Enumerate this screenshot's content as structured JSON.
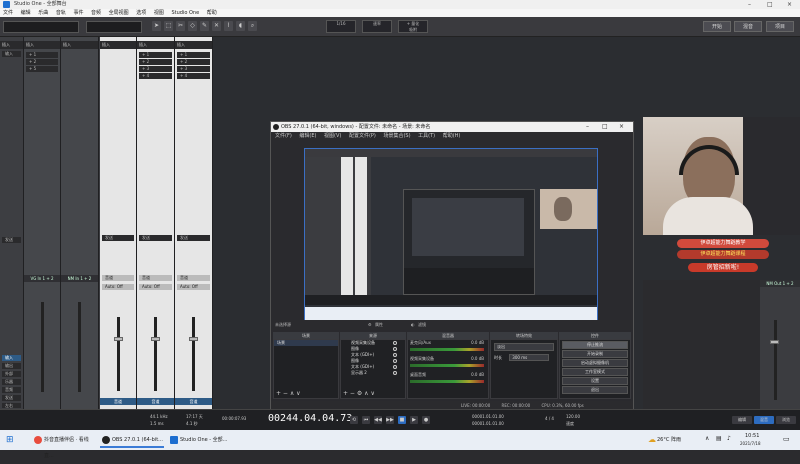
{
  "studio_one": {
    "window_title": "Studio One - 全部舞台",
    "menu": [
      "文件",
      "编辑",
      "乐曲",
      "音轨",
      "事件",
      "音频",
      "全局视图",
      "选项",
      "视图",
      "Studio One",
      "帮助"
    ],
    "toolbar": {
      "display_1": "1/16",
      "display_2": "速率",
      "display_3": "+ 量化",
      "display_4": "吸附",
      "right_btn_1": "开始",
      "right_btn_2": "混音",
      "right_btn_3": "项目"
    },
    "mixer": {
      "insert_label": "插入",
      "inputs_label": "输入",
      "send_label": "发送",
      "routes": [
        "+ 1",
        "+ 2",
        "+ 3",
        "+ 4",
        "+ 5"
      ],
      "bus_in_a": "VG In 1 + 2",
      "bus_in_b": "NM In 1 + 2",
      "auto_label": "Auto: Off",
      "ch_labels": [
        "音道",
        "音道",
        "音道"
      ],
      "ch_names": [
        "音道",
        "音道",
        "音道"
      ],
      "side_buttons": [
        "输入",
        "输出",
        "外部",
        "乐器",
        "音频",
        "发送",
        "左右"
      ],
      "main_bus": "NM Out 1 + 2"
    }
  },
  "obs": {
    "title": "OBS 27.0.1 (64-bit, windows) - 配置文件: 未命名 - 场景: 未命名",
    "menu": [
      "文件(F)",
      "编辑(E)",
      "视图(V)",
      "配置文件(P)",
      "场景集合(S)",
      "工具(T)",
      "帮助(H)"
    ],
    "status_left": "未选择源",
    "status_props": "属性",
    "status_filters": "滤镜",
    "docks": {
      "scenes": "场景",
      "sources": "来源",
      "mixer": "混音器",
      "transitions": "转场特效",
      "controls": "控件"
    },
    "scenes": [
      "场景"
    ],
    "sources": [
      "视频采集设备",
      "图像",
      "文本 (GDI+)",
      "图像",
      "文本 (GDI+)",
      "显示器 2"
    ],
    "mixer_rows": [
      {
        "name": "麦克风/Aux",
        "level": "0.0 dB"
      },
      {
        "name": "视频采集设备",
        "level": "0.0 dB"
      },
      {
        "name": "桌面音频",
        "level": "0.0 dB"
      }
    ],
    "transition": {
      "type": "淡出",
      "duration_label": "时长",
      "duration": "300 ms"
    },
    "controls": [
      "停止推流",
      "开始录制",
      "启动虚拟摄像机",
      "工作室模式",
      "设置",
      "退出"
    ],
    "bottom": {
      "live": "LIVE: 00:00:00",
      "rec": "REC: 00:00:00",
      "cpu": "CPU: 0.3%, 60.00 fps"
    }
  },
  "stream_overlay": {
    "banner_1": "伊卓超能力舞蹈教学",
    "banner_2": "伊卓超能力舞蹈课程",
    "banner_3": "房管招新啦!"
  },
  "transport": {
    "sample_rate": "44.1 kHz",
    "latency": "1.5 ms",
    "time_label": "17:17 天",
    "record_max": "4.1 秒",
    "position_small": "00:00:07.93",
    "position_big": "00244.04.04.73",
    "marker_l": "00001.01.01.00",
    "marker_r": "00001.01.01.00",
    "time_sig": "4 / 4",
    "tempo": "120.00",
    "key": "速度",
    "edit_btn": "编辑",
    "mix_btn": "混音",
    "browse_btn": "浏览"
  },
  "taskbar": {
    "apps": [
      "抖音直播伴侣 · 看线直...",
      "OBS 27.0.1 (64-bit...",
      "Studio One - 全部..."
    ],
    "weather": "26°C 阵雨",
    "time": "10:51",
    "date": "2021/7/18"
  },
  "colors": {
    "obs_selection": "#3b6fc4",
    "s1_blue": "#2e5b86",
    "meter_green": "#3a9a3a"
  }
}
